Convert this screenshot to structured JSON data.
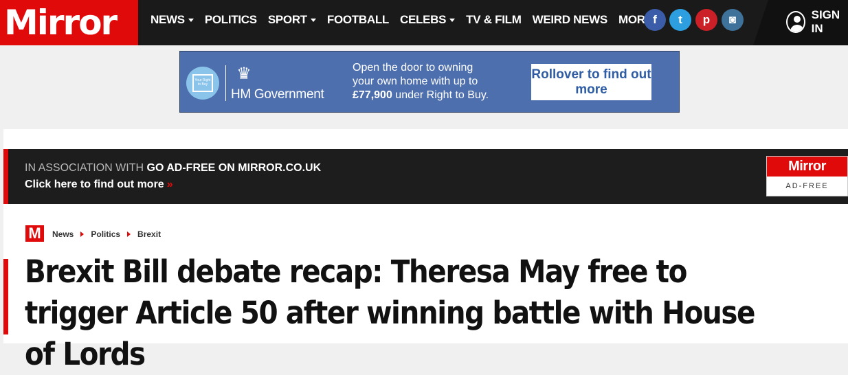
{
  "header": {
    "logo": "Mirror",
    "nav": [
      {
        "label": "NEWS",
        "caret": true
      },
      {
        "label": "POLITICS",
        "caret": false
      },
      {
        "label": "SPORT",
        "caret": true
      },
      {
        "label": "FOOTBALL",
        "caret": false
      },
      {
        "label": "CELEBS",
        "caret": true
      },
      {
        "label": "TV & FILM",
        "caret": false
      },
      {
        "label": "WEIRD NEWS",
        "caret": false
      },
      {
        "label": "MORE",
        "caret": true
      }
    ],
    "social": {
      "facebook": "f",
      "twitter": "t",
      "pinterest": "p",
      "instagram": "◙"
    },
    "signin": "SIGN IN"
  },
  "ad": {
    "badge_text": "Your Right to Buy",
    "crest": "♛",
    "sponsor": "HM Government",
    "copy_line1": "Open the door to owning",
    "copy_line2": "your own home with up to",
    "copy_amount": "£77,900",
    "copy_line3_rest": " under Right to Buy.",
    "cta": "Rollover to find out more",
    "bg_color": "#4e6fae"
  },
  "association": {
    "prefix": "IN ASSOCIATION WITH ",
    "bold": "GO AD-FREE ON MIRROR.CO.UK",
    "cta": "Click here to find out more",
    "cta_arrow": "»",
    "badge_top": "Mirror",
    "badge_bottom": "AD-FREE"
  },
  "breadcrumb": {
    "logo": "M",
    "items": [
      "News",
      "Politics",
      "Brexit"
    ]
  },
  "article": {
    "headline": "Brexit Bill debate recap: Theresa May free to trigger Article 50 after winning battle with House of Lords"
  },
  "colors": {
    "brand_red": "#e10a0a",
    "nav_bg": "#1a1a1a"
  }
}
